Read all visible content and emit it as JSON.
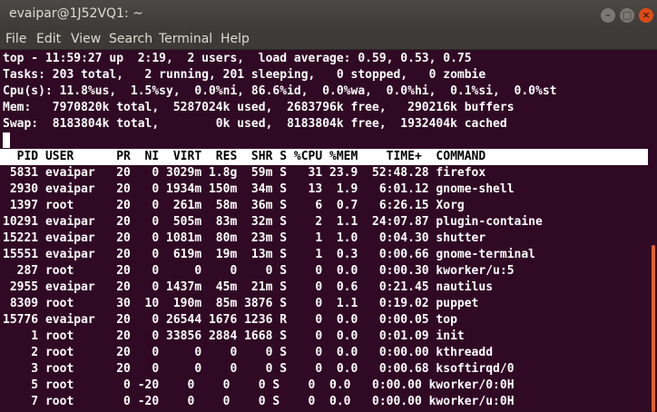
{
  "window": {
    "title": "evaipar@1J52VQ1: ~"
  },
  "menubar": {
    "items": [
      "File",
      "Edit",
      "View",
      "Search",
      "Terminal",
      "Help"
    ]
  },
  "summary": {
    "top": "top - 11:59:27 up  2:19,  2 users,  load average: 0.59, 0.53, 0.75",
    "tasks": "Tasks: 203 total,   2 running, 201 sleeping,   0 stopped,   0 zombie",
    "cpu": "Cpu(s): 11.8%us,  1.5%sy,  0.0%ni, 86.6%id,  0.0%wa,  0.0%hi,  0.1%si,  0.0%st",
    "mem": "Mem:   7970820k total,  5287024k used,  2683796k free,   290216k buffers",
    "swap": "Swap:  8183804k total,        0k used,  8183804k free,  1932404k cached"
  },
  "header": "  PID USER      PR  NI  VIRT  RES  SHR S %CPU %MEM    TIME+  COMMAND",
  "rows": [
    " 5831 evaipar   20   0 3029m 1.8g  59m S   31 23.9  52:48.28 firefox",
    " 2930 evaipar   20   0 1934m 150m  34m S   13  1.9   6:01.12 gnome-shell",
    " 1397 root      20   0  261m  58m  36m S    6  0.7   6:26.15 Xorg",
    "10291 evaipar   20   0  505m  83m  32m S    2  1.1  24:07.87 plugin-containe",
    "15221 evaipar   20   0 1081m  80m  23m S    1  1.0   0:04.30 shutter",
    "15551 evaipar   20   0  619m  19m  13m S    1  0.3   0:00.66 gnome-terminal",
    "  287 root      20   0     0    0    0 S    0  0.0   0:00.30 kworker/u:5",
    " 2955 evaipar   20   0 1437m  45m  21m S    0  0.6   0:21.45 nautilus",
    " 8309 root      30  10  190m  85m 3876 S    0  1.1   0:19.02 puppet",
    "15776 evaipar   20   0 26544 1676 1236 R    0  0.0   0:00.05 top",
    "    1 root      20   0 33856 2884 1668 S    0  0.0   0:01.09 init",
    "    2 root      20   0     0    0    0 S    0  0.0   0:00.00 kthreadd",
    "    3 root      20   0     0    0    0 S    0  0.0   0:00.68 ksoftirqd/0",
    "    5 root       0 -20    0    0    0 S    0  0.0   0:00.00 kworker/0:0H",
    "    7 root       0 -20    0    0    0 S    0  0.0   0:00.00 kworker/u:0H"
  ]
}
